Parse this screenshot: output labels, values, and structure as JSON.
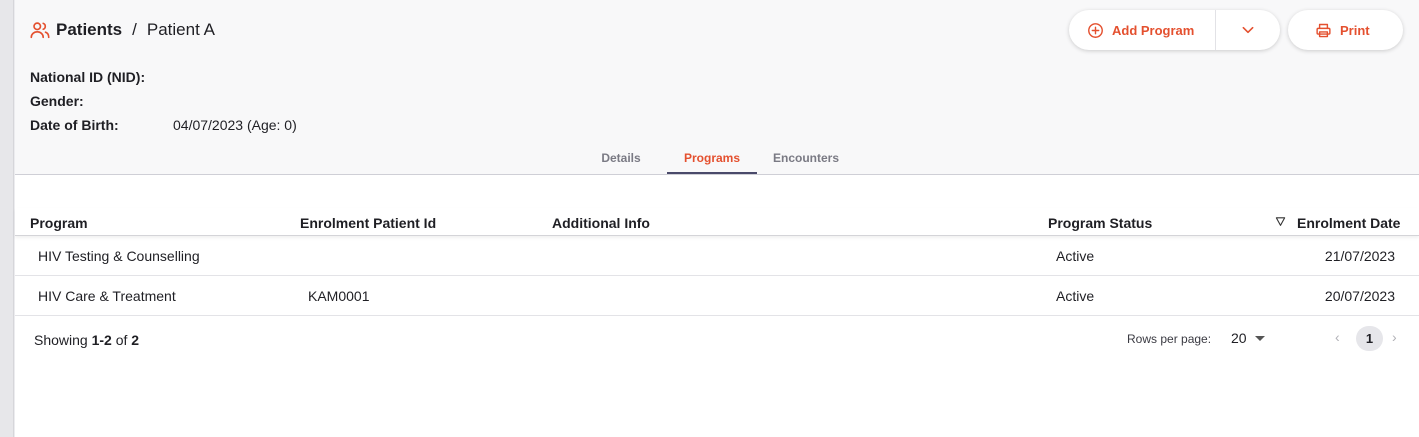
{
  "breadcrumb": {
    "icon": "users-icon",
    "section": "Patients",
    "separator": "/",
    "current": "Patient A"
  },
  "patient_fields": [
    {
      "label": "National ID (NID):",
      "value": ""
    },
    {
      "label": "Gender:",
      "value": ""
    },
    {
      "label": "Date of Birth:",
      "value": "04/07/2023 (Age: 0)"
    }
  ],
  "actions": {
    "add_program": "Add Program",
    "print": "Print",
    "accent": "#e4502f"
  },
  "tabs": [
    {
      "label": "Details",
      "active": false
    },
    {
      "label": "Programs",
      "active": true
    },
    {
      "label": "Encounters",
      "active": false
    }
  ],
  "table": {
    "columns": [
      "Program",
      "Enrolment Patient Id",
      "Additional Info",
      "Program Status",
      "Enrolment Date"
    ],
    "rows": [
      [
        "HIV Testing & Counselling",
        "",
        "",
        "Active",
        "21/07/2023"
      ],
      [
        "HIV Care & Treatment",
        "KAM0001",
        "",
        "Active",
        "20/07/2023"
      ]
    ]
  },
  "pagination": {
    "showing_prefix": "Showing",
    "range": "1-2",
    "of_word": "of",
    "total": "2",
    "rows_per_page_label": "Rows per page:",
    "rows_per_page_value": "20",
    "current_page": "1",
    "prev": "‹",
    "next": "›"
  }
}
